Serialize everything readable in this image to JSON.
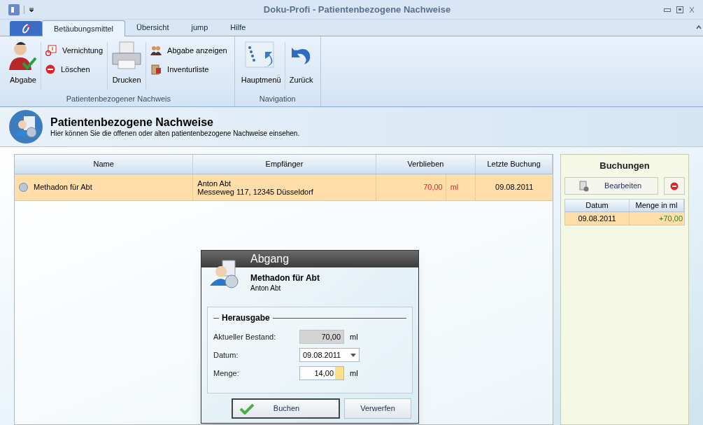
{
  "window": {
    "title": "Doku-Profi - Patientenbezogene Nachweise"
  },
  "tabs": [
    {
      "label": "Betäubungsmittel",
      "selected": true
    },
    {
      "label": "Übersicht",
      "selected": false
    },
    {
      "label": "jump",
      "selected": false
    },
    {
      "label": "Hilfe",
      "selected": false
    }
  ],
  "ribbon_groups": [
    {
      "label": "Patientenbezogener Nachweis",
      "items": [
        {
          "kind": "large",
          "label": "Abgabe"
        },
        {
          "kind": "stack",
          "items": [
            {
              "label": "Vernichtung"
            },
            {
              "label": "Löschen"
            }
          ]
        },
        {
          "kind": "large",
          "label": "Drucken"
        },
        {
          "kind": "stack",
          "items": [
            {
              "label": "Abgabe anzeigen"
            },
            {
              "label": "Inventurliste"
            }
          ]
        }
      ]
    },
    {
      "label": "Navigation",
      "items": [
        {
          "kind": "large",
          "label": "Hauptmenü"
        },
        {
          "kind": "large",
          "label": "Zurück"
        }
      ]
    }
  ],
  "header": {
    "title": "Patientenbezogene Nachweise",
    "subtitle": "Hier können Sie die offenen oder alten patientenbezogene Nachweise einsehen."
  },
  "table": {
    "columns": [
      "Name",
      "Empfänger",
      "Verblieben",
      "Letzte Buchung"
    ],
    "rows": [
      {
        "name": "Methadon für Abt",
        "recipient": [
          "Anton Abt",
          "Messeweg 117, 12345 Düsseldorf"
        ],
        "remaining": "70,00",
        "unit": "ml",
        "last_booking": "09.08.2011",
        "selected": true
      }
    ]
  },
  "bookings": {
    "title": "Buchungen",
    "edit_button": "Bearbeiten",
    "columns": [
      "Datum",
      "Menge in ml"
    ],
    "rows": [
      {
        "date": "09.08.2011",
        "amount": "+70,00",
        "selected": true
      }
    ]
  },
  "dialog": {
    "title": "Abgang",
    "item": "Methadon für Abt",
    "person": "Anton Abt",
    "group": "Herausgabe",
    "fields": [
      {
        "kind": "readonly",
        "label": "Aktueller Bestand:",
        "value": "70,00",
        "unit": "ml"
      },
      {
        "kind": "dropdown",
        "label": "Datum:",
        "value": "09.08.2011"
      },
      {
        "kind": "spinner",
        "label": "Menge:",
        "value": "14,00",
        "unit": "ml"
      }
    ],
    "buttons": [
      {
        "label": "Buchen",
        "default": true
      },
      {
        "label": "Verwerfen",
        "default": false
      }
    ]
  }
}
